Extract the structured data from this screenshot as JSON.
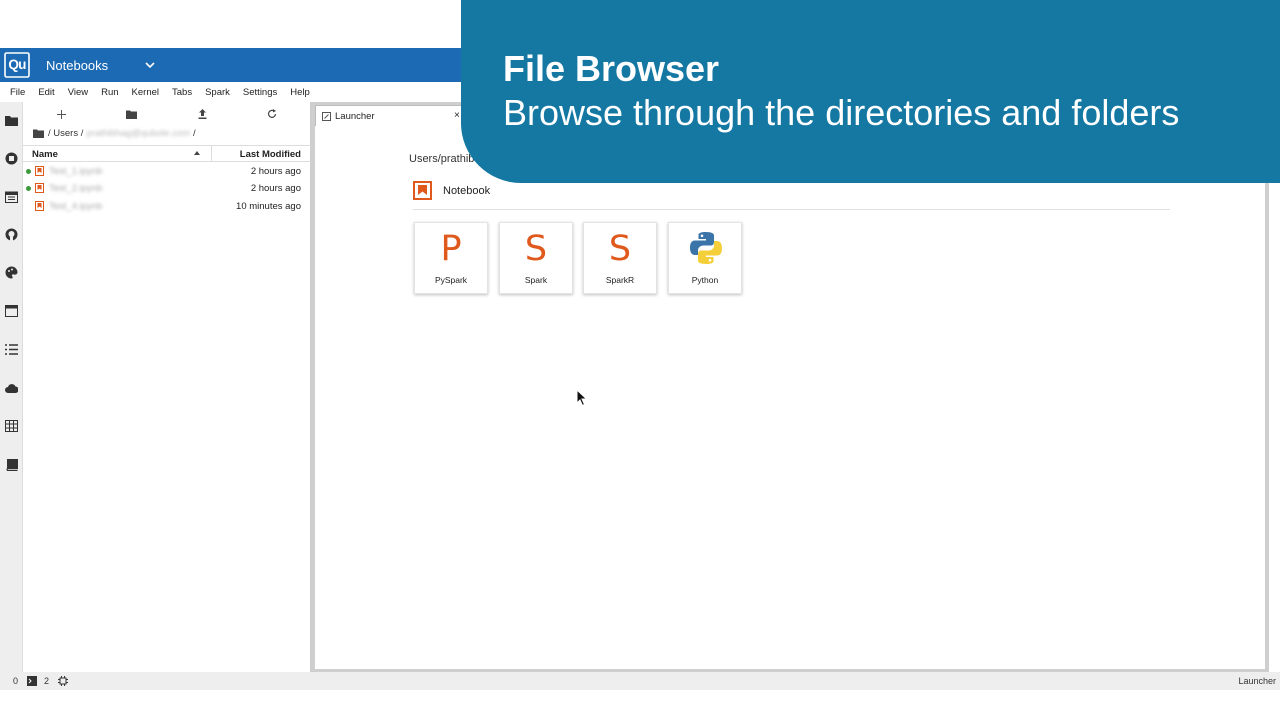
{
  "app": {
    "logo_text": "Qu",
    "title": "Notebooks"
  },
  "menu": [
    "File",
    "Edit",
    "View",
    "Run",
    "Kernel",
    "Tabs",
    "Spark",
    "Settings",
    "Help"
  ],
  "file_browser": {
    "breadcrumb_prefix": "/ Users /",
    "breadcrumb_user": "prathibhag@qubole.com",
    "breadcrumb_suffix": "/",
    "col_name": "Name",
    "col_modified": "Last Modified",
    "files": [
      {
        "name": "Test_1.ipynb",
        "modified": "2 hours ago",
        "running": true
      },
      {
        "name": "Test_2.ipynb",
        "modified": "2 hours ago",
        "running": true
      },
      {
        "name": "Test_4.ipynb",
        "modified": "10 minutes ago",
        "running": false
      }
    ]
  },
  "tab": {
    "label": "Launcher",
    "close": "×"
  },
  "launcher": {
    "cwd": "Users/prathib",
    "section_title": "Notebook",
    "kernels": [
      {
        "glyph": "P",
        "label": "PySpark"
      },
      {
        "glyph": "S",
        "label": "Spark"
      },
      {
        "glyph": "S",
        "label": "SparkR"
      },
      {
        "glyph": "",
        "label": "Python"
      }
    ]
  },
  "status": {
    "left_count": "0",
    "terminals": "2",
    "right_label": "Launcher"
  },
  "banner": {
    "title": "File Browser",
    "subtitle": "Browse through the directories and folders"
  },
  "colors": {
    "header_blue": "#1b6ab3",
    "banner_blue": "#1478a3",
    "kernel_orange": "#e0591c",
    "running_green": "#3b9a3b"
  }
}
